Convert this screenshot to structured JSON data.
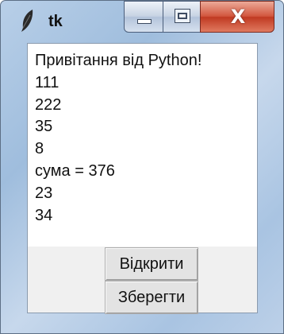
{
  "window": {
    "title": "tk",
    "icon": "feather-icon",
    "controls": [
      "minimize-icon",
      "maximize-icon",
      "close-icon"
    ],
    "close_glyph": "X"
  },
  "text_area": {
    "lines": [
      "Привітання від Python!",
      "111",
      "222",
      "35",
      "8",
      "сума = 376",
      "23",
      "34"
    ]
  },
  "buttons": {
    "open_label": "Відкрити",
    "save_label": "Зберегти"
  },
  "colors": {
    "close_button": "#c8472e",
    "frame": "#a9c4e2"
  }
}
